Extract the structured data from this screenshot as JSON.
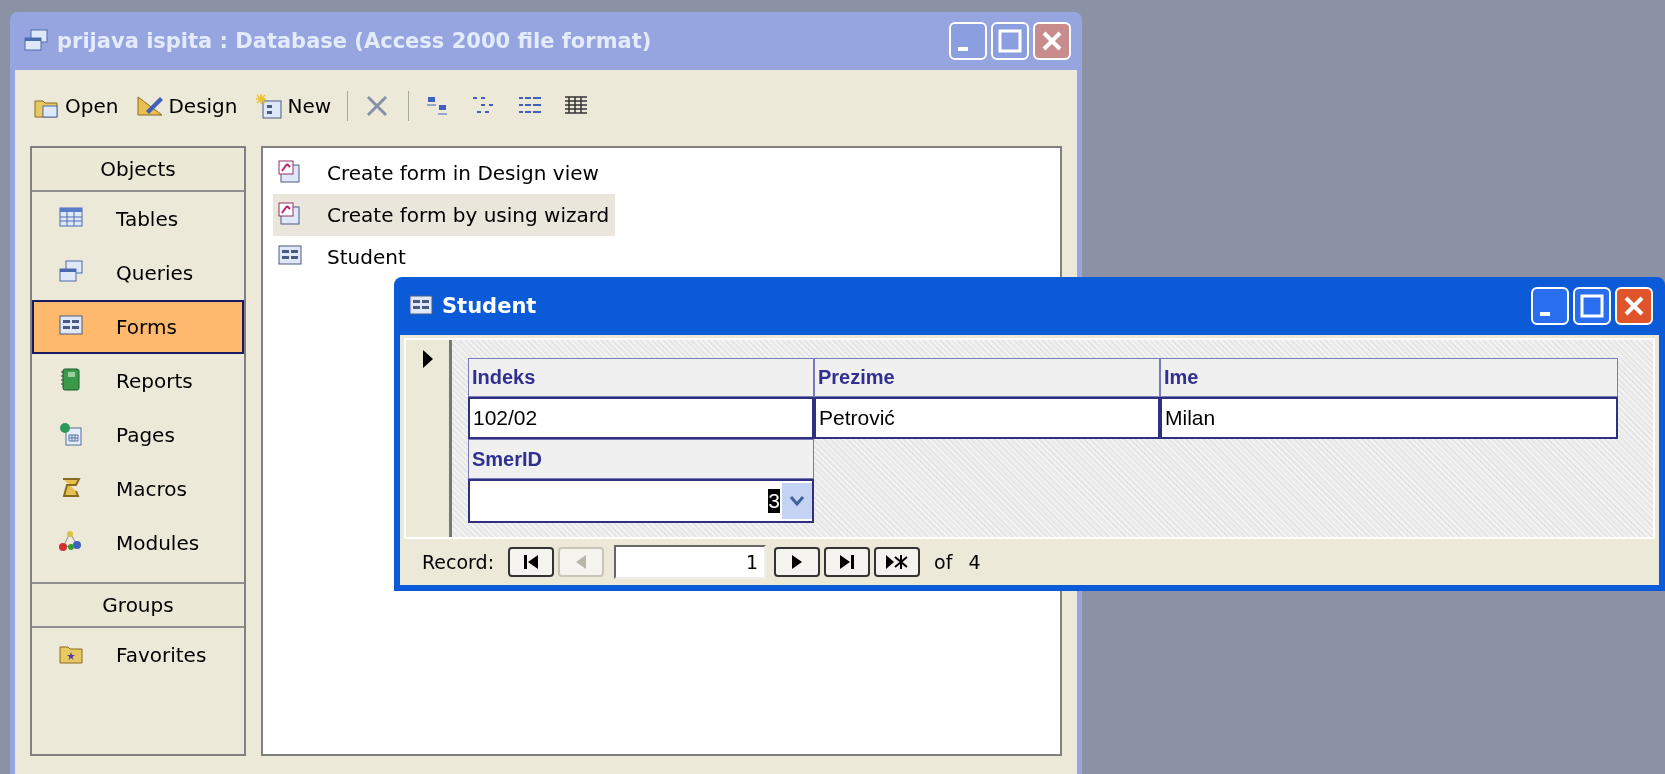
{
  "main_window": {
    "title": "prijava ispita : Database (Access 2000 file format)",
    "active": false
  },
  "toolbar": [
    {
      "kind": "open",
      "label": "Open"
    },
    {
      "kind": "design",
      "label": "Design"
    },
    {
      "kind": "new",
      "label": "New"
    },
    {
      "kind": "separator"
    },
    {
      "kind": "delete"
    },
    {
      "kind": "separator"
    },
    {
      "kind": "large-icons"
    },
    {
      "kind": "small-icons"
    },
    {
      "kind": "list"
    },
    {
      "kind": "details"
    }
  ],
  "objects_bar": {
    "header": "Objects",
    "items": [
      {
        "kind": "tables",
        "label": "Tables",
        "selected": false
      },
      {
        "kind": "queries",
        "label": "Queries",
        "selected": false
      },
      {
        "kind": "forms",
        "label": "Forms",
        "selected": true
      },
      {
        "kind": "reports",
        "label": "Reports",
        "selected": false
      },
      {
        "kind": "pages",
        "label": "Pages",
        "selected": false
      },
      {
        "kind": "macros",
        "label": "Macros",
        "selected": false
      },
      {
        "kind": "modules",
        "label": "Modules",
        "selected": false
      }
    ],
    "groups_header": "Groups",
    "groups": [
      {
        "kind": "favorites",
        "label": "Favorites",
        "selected": false
      }
    ]
  },
  "list": [
    {
      "kind": "shortcut",
      "label": "Create form in Design view",
      "selected": false
    },
    {
      "kind": "shortcut",
      "label": "Create form by using wizard",
      "selected": true
    },
    {
      "kind": "form",
      "label": "Student",
      "selected": false
    }
  ],
  "form_window": {
    "title": "Student",
    "active": true,
    "current_record_marker": true,
    "fields_row": [
      {
        "label": "Indeks",
        "value": "102/02"
      },
      {
        "label": "Prezime",
        "value": "Petrović"
      },
      {
        "label": "Ime",
        "value": "Milan"
      }
    ],
    "combo": {
      "label": "SmerID",
      "value": "3",
      "value_selected": true
    },
    "navigation": {
      "label": "Record:",
      "current": "1",
      "of": "of",
      "total": "4",
      "buttons": [
        {
          "kind": "first",
          "disabled": false
        },
        {
          "kind": "previous",
          "disabled": true
        },
        {
          "kind": "field"
        },
        {
          "kind": "next",
          "disabled": false
        },
        {
          "kind": "last",
          "disabled": false
        },
        {
          "kind": "new",
          "disabled": false
        }
      ]
    }
  }
}
